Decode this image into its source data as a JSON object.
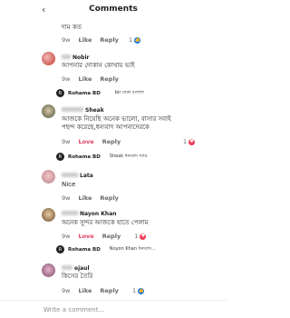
{
  "header": {
    "title": "Comments",
    "back_icon": "‹"
  },
  "comments": [
    {
      "name": "",
      "text": "দাম কত",
      "time": "9w",
      "like_label": "Like",
      "reply_label": "Reply",
      "reaction_count": "1",
      "reaction": "like"
    },
    {
      "name": "Nobir",
      "text": "আপনার দোকান কোথায় ভাই",
      "time": "9w",
      "like_label": "Like",
      "reply_label": "Reply",
      "reply": {
        "author": "Rohama BD",
        "text": "bir ঢাকা বংশাল"
      }
    },
    {
      "name": "Sheak",
      "text_line1": "আজকে নিয়েছি অনেক ভালো, বাসার সবাই",
      "text_line2": "পছন্দ করেছে,ধন্যবাদ আপনাদেরকে",
      "time": "9w",
      "like_label": "Love",
      "reply_label": "Reply",
      "reaction_count": "1",
      "reaction": "love",
      "reply": {
        "author": "Rohama BD",
        "text": "Sheak ধন্যবাদ স্যার"
      }
    },
    {
      "name": "Lata",
      "text": "Nice",
      "time": "9w",
      "like_label": "Like",
      "reply_label": "Reply"
    },
    {
      "name": "Nayon Khan",
      "text": "অনেক সুন্দর আজকে হাতে পেলাম",
      "time": "9w",
      "like_label": "Love",
      "reply_label": "Reply",
      "reaction_count": "1",
      "reaction": "love",
      "reply": {
        "author": "Rohama BD",
        "text": "Noyon Khan ধন্যবাদ..."
      }
    },
    {
      "name": "ejaul",
      "text": "কিসের তৈরি",
      "time": "9w",
      "like_label": "Like",
      "reply_label": "Reply",
      "reaction_count": "1",
      "reaction": "like"
    }
  ],
  "footer": {
    "placeholder": "Write a comment..."
  },
  "colors": {
    "love": "#e4405f",
    "like": "#1877f2",
    "meta": "#65676b"
  }
}
